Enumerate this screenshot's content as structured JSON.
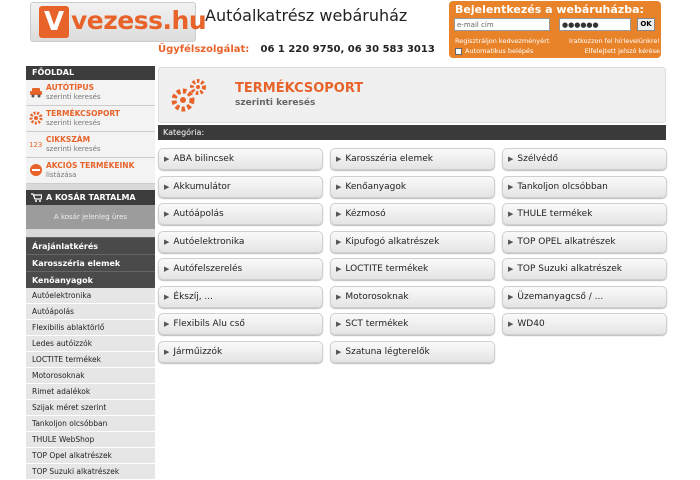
{
  "header": {
    "logo_v": "V",
    "logo_text": "vezess.hu",
    "site_title": "Autóalkatrész webáruház",
    "phone_label": "Ügyfélszolgálat:",
    "phone_value": "06 1 220 9750, 06 30 583 3013"
  },
  "login": {
    "title": "Bejelentkezés a webáruházba:",
    "email_value": "e-mail cím",
    "password_value": "●●●●●●",
    "ok_label": "OK",
    "register": "Regisztráljon kedvezményért",
    "newsletter": "Iratkozzon fel hírlevelünkre!",
    "auto_login": "Automatikus belépés",
    "forgot": "Elfelejtett jelszó kérése"
  },
  "sidebar": {
    "home": "FŐOLDAL",
    "searches": [
      {
        "title": "AUTÓTÍPUS",
        "sub": "szerinti keresés",
        "icon": "car-icon"
      },
      {
        "title": "TERMÉKCSOPORT",
        "sub": "szerinti keresés",
        "icon": "gear-icon"
      },
      {
        "title": "CIKKSZÁM",
        "sub": "szerinti keresés",
        "icon": "number-icon"
      },
      {
        "title": "AKCIÓS TERMÉKEINK",
        "sub": "listázása",
        "icon": "sale-icon"
      }
    ],
    "cart_title": "A KOSÁR TARTALMA",
    "cart_empty": "A kosár jelenleg üres",
    "categories": [
      "Árajánlatkérés",
      "Karosszéria elemek",
      "Kenőanyagok"
    ],
    "subitems": [
      "Autóelektronika",
      "Autóápolás",
      "Flexibilis ablaktörlő",
      "Ledes autóizzók",
      "LOCTITE termékek",
      "Motorosoknak",
      "Rimet adalékok",
      "Szijak méret szerint",
      "Tankoljon olcsóbban",
      "THULE WebShop",
      "TOP Opel alkatrészek",
      "TOP Suzuki alkatrészek"
    ]
  },
  "main": {
    "title": "TERMÉKCSOPORT",
    "subtitle": "szerinti keresés",
    "category_label": "Kategória:",
    "columns": [
      [
        "ABA bilincsek",
        "Akkumulátor",
        "Autóápolás",
        "Autóelektronika",
        "Autófelszerelés",
        "Ékszíj, ...",
        "Flexibils Alu cső",
        "Járműizzók"
      ],
      [
        "Karosszéria elemek",
        "Kenőanyagok",
        "Kézmosó",
        "Kipufogó alkatrészek",
        "LOCTITE termékek",
        "Motorosoknak",
        "SCT termékek",
        "Szatuna légterelők"
      ],
      [
        "Szélvédő",
        "Tankoljon olcsóbban",
        "THULE termékek",
        "TOP OPEL alkatrészek",
        "TOP Suzuki alkatrészek",
        "Üzemanyagcső / ...",
        "WD40"
      ]
    ]
  },
  "colors": {
    "accent": "#e8632a",
    "dark": "#3a3a3a"
  }
}
